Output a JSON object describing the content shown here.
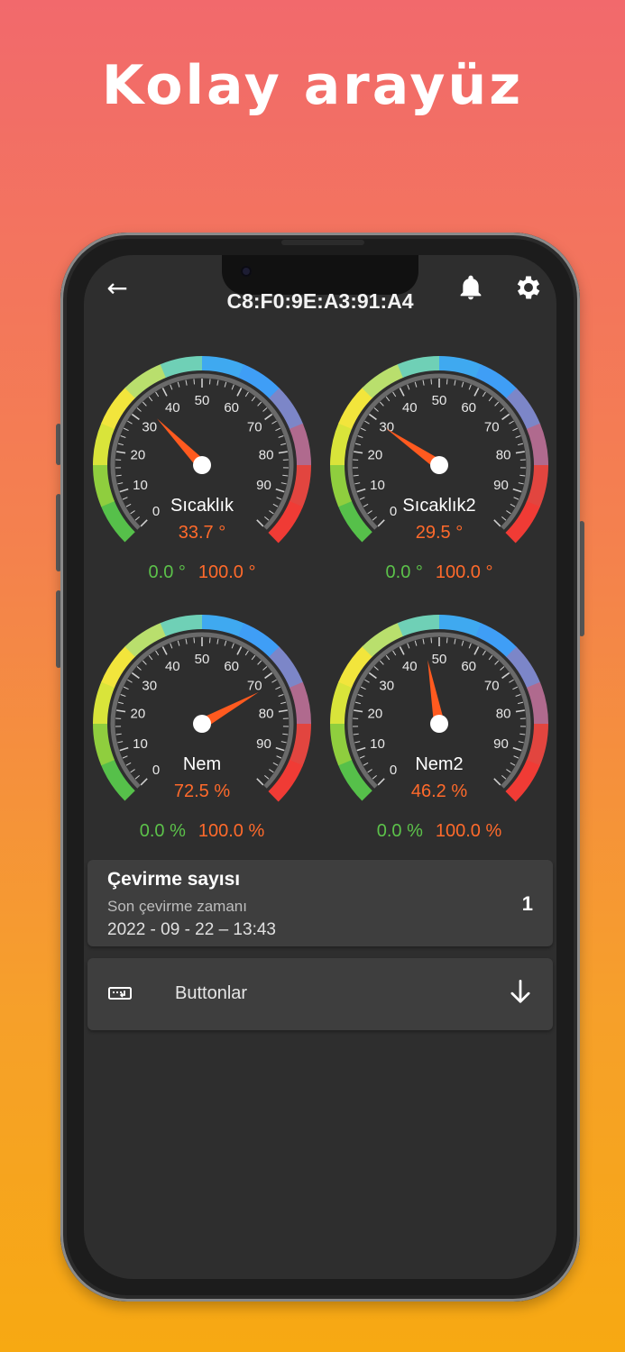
{
  "headline": "Kolay arayüz",
  "topbar": {
    "device_id": "C8:F0:9E:A3:91:A4",
    "back_icon": "arrow-left-icon",
    "bell_icon": "bell-icon",
    "settings_icon": "gear-icon"
  },
  "gauges": [
    {
      "label": "Sıcaklık",
      "value": 33.7,
      "value_text": "33.7 °",
      "min_text": "0.0 °",
      "max_text": "100.0 °",
      "ticks": [
        "0",
        "10",
        "20",
        "30",
        "40",
        "50",
        "60",
        "70",
        "80",
        "90"
      ]
    },
    {
      "label": "Sıcaklık2",
      "value": 29.5,
      "value_text": "29.5 °",
      "min_text": "0.0 °",
      "max_text": "100.0 °",
      "ticks": [
        "0",
        "10",
        "20",
        "30",
        "40",
        "50",
        "60",
        "70",
        "80",
        "90"
      ]
    },
    {
      "label": "Nem",
      "value": 72.5,
      "value_text": "72.5 %",
      "min_text": "0.0 %",
      "max_text": "100.0 %",
      "ticks": [
        "0",
        "10",
        "20",
        "30",
        "40",
        "50",
        "60",
        "70",
        "80",
        "90"
      ]
    },
    {
      "label": "Nem2",
      "value": 46.2,
      "value_text": "46.2 %",
      "min_text": "0.0 %",
      "max_text": "100.0 %",
      "ticks": [
        "0",
        "10",
        "20",
        "30",
        "40",
        "50",
        "60",
        "70",
        "80",
        "90"
      ]
    }
  ],
  "counter_card": {
    "title": "Çevirme sayısı",
    "subtitle": "Son çevirme zamanı",
    "datetime": "2022 - 09 - 22 – 13:43",
    "count": "1"
  },
  "buttons_card": {
    "label": "Buttonlar",
    "icon": "keyboard-icon",
    "arrow_icon": "arrow-down-icon"
  },
  "colors": {
    "accent_orange": "#ff6a2b",
    "min_green": "#5cc24a",
    "screen_bg": "#2e2e2e",
    "card_bg": "#3e3e3e"
  }
}
